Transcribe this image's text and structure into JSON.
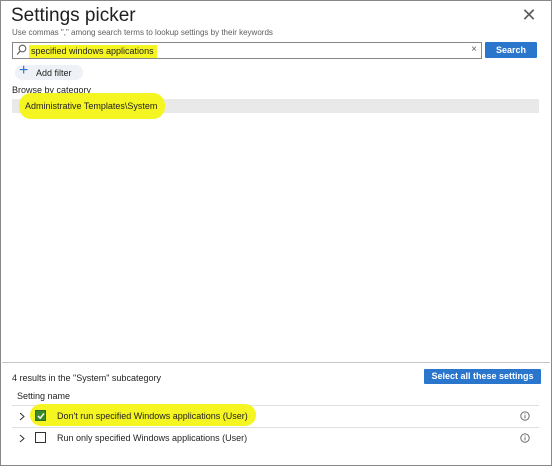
{
  "header": {
    "title": "Settings picker",
    "subtitle": "Use commas \",\" among search terms to lookup settings by their keywords"
  },
  "search": {
    "value": "specified windows applications",
    "clear_symbol": "×",
    "button_label": "Search"
  },
  "filter": {
    "add_label": "Add filter"
  },
  "browse": {
    "label": "Browse by category",
    "categories": [
      {
        "label": "Administrative Templates\\System",
        "selected": true
      }
    ]
  },
  "results": {
    "count_text": "4 results in the \"System\" subcategory",
    "select_all_label": "Select all these settings",
    "column_header": "Setting name",
    "rows": [
      {
        "label": "Don't run specified Windows applications (User)",
        "checked": true
      },
      {
        "label": "Run only specified Windows applications (User)",
        "checked": false
      }
    ]
  },
  "colors": {
    "accent": "#2a76cc",
    "highlight": "#f5f522",
    "checkbox_checked": "#3a8a2c"
  }
}
